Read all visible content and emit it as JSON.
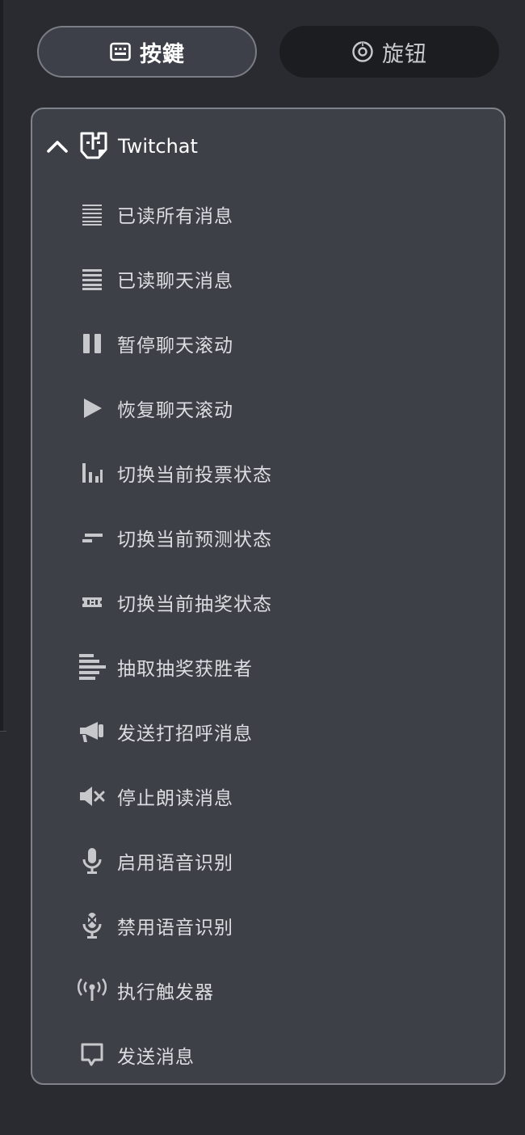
{
  "tabs": [
    {
      "label": "按鍵",
      "icon": "keyboard-icon",
      "active": true
    },
    {
      "label": "旋钮",
      "icon": "dial-icon",
      "active": false
    }
  ],
  "group": {
    "title": "Twitchat",
    "expanded": true,
    "icon": "twitchat-logo"
  },
  "items": [
    {
      "label": "已读所有消息",
      "icon": "lines-all-icon"
    },
    {
      "label": "已读聊天消息",
      "icon": "lines-chat-icon"
    },
    {
      "label": "暂停聊天滚动",
      "icon": "pause-icon"
    },
    {
      "label": "恢复聊天滚动",
      "icon": "play-icon"
    },
    {
      "label": "切换当前投票状态",
      "icon": "poll-icon"
    },
    {
      "label": "切换当前预测状态",
      "icon": "prediction-icon"
    },
    {
      "label": "切换当前抽奖状态",
      "icon": "ticket-icon"
    },
    {
      "label": "抽取抽奖获胜者",
      "icon": "list-icon"
    },
    {
      "label": "发送打招呼消息",
      "icon": "megaphone-icon"
    },
    {
      "label": "停止朗读消息",
      "icon": "mute-icon"
    },
    {
      "label": "启用语音识别",
      "icon": "microphone-icon"
    },
    {
      "label": "禁用语音识别",
      "icon": "microphone-off-icon"
    },
    {
      "label": "执行触发器",
      "icon": "broadcast-icon"
    },
    {
      "label": "发送消息",
      "icon": "message-icon"
    }
  ],
  "colors": {
    "background": "#2a2b30",
    "panel": "#3e4048",
    "active_tab": "#3d4048",
    "inactive_tab": "#1c1d20",
    "text": "#dcdde0",
    "icon": "#c7c8cb"
  }
}
